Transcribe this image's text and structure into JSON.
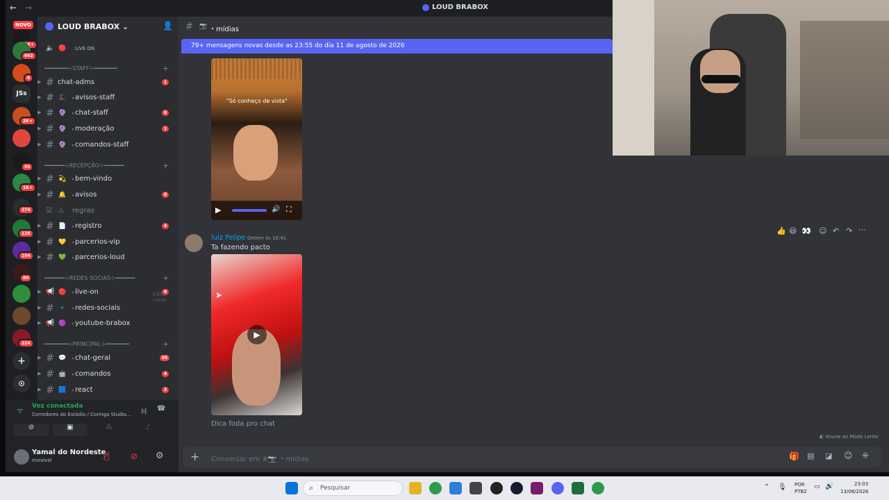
{
  "window": {
    "back": "←",
    "fwd": "→",
    "title": "LOUD BRABOX"
  },
  "servers": {
    "novo": "NOVO",
    "items": [
      {
        "badge": "1K+"
      },
      {
        "badge": "642"
      },
      {
        "badge": "6"
      },
      {
        "label": "JSs"
      },
      {
        "badge": "2K+"
      },
      {
        "badge": ""
      },
      {
        "badge": "95"
      },
      {
        "badge": "1K+"
      },
      {
        "badge": "374"
      },
      {
        "badge": "128"
      },
      {
        "badge": "104"
      },
      {
        "badge": "80"
      },
      {
        "badge": ""
      },
      {
        "badge": ""
      },
      {
        "badge": "224"
      }
    ],
    "add": "+",
    "explore": "⊙"
  },
  "server_name": "LOUD BRABOX",
  "channels": {
    "live_on_top": "LIVE ON",
    "cat_staff": "━━━━━━━⊹STAFF⊹━━━━━━━",
    "cat_recepcao": "━━━━━━⊹RECEPÇÃO⊹━━━━━━",
    "cat_redes": "━━━━━━⊹REDES SOCIAS⊹━━━━━━",
    "cat_principal": "━━━━━━━⊹PRINCIPAL⊹━━━━━━━",
    "items": [
      {
        "label": "chat-adms",
        "count": "1",
        "emoji": ""
      },
      {
        "label": "avisos-staff",
        "count": "",
        "emoji": "🎩"
      },
      {
        "label": "chat-staff",
        "count": "6",
        "emoji": "🔮"
      },
      {
        "label": "moderação",
        "count": "1",
        "emoji": "🔮"
      },
      {
        "label": "comandos-staff",
        "count": "",
        "emoji": "🔮"
      },
      {
        "label": "bem-vindo",
        "count": "",
        "emoji": "💫"
      },
      {
        "label": "avisos",
        "count": "8",
        "emoji": "🔔"
      },
      {
        "label": "regras",
        "count": "",
        "emoji": "⚠"
      },
      {
        "label": "registro",
        "count": "4",
        "emoji": "📄"
      },
      {
        "label": "parcerios-vip",
        "count": "",
        "emoji": "💛"
      },
      {
        "label": "parcerios-loud",
        "count": "",
        "emoji": "💚"
      },
      {
        "label": "live-on",
        "count": "6",
        "emoji": "🔴"
      },
      {
        "label": "redes-sociais",
        "count": "",
        "emoji": "🔹"
      },
      {
        "label": "youtube-brabox",
        "count": "",
        "emoji": "🟣"
      },
      {
        "label": "chat-geral",
        "count": "85",
        "emoji": "💬"
      },
      {
        "label": "comandos",
        "count": "4",
        "emoji": "🤖"
      },
      {
        "label": "react",
        "count": "3",
        "emoji": "🟦"
      }
    ],
    "tooltip": "Editar canal"
  },
  "voice": {
    "status": "Voz conectada",
    "location": "Corredores do Estádio / Coringa Studio..."
  },
  "user": {
    "name": "Yamal do Nordeste",
    "status": "Invisível"
  },
  "header": {
    "channel": "mídias"
  },
  "banner": "79+ mensagens novas desde as 23:55 do dia 11 de agosto de 2026",
  "video1": {
    "caption": "\"Só conheço de vista\""
  },
  "message": {
    "author": "luiz Felipe",
    "time": "Ontem às 16:41",
    "text": "Ta fazendo pacto",
    "next": "Dica foda pro chat"
  },
  "slowmode": "Imune ao Modo Lento",
  "composer": {
    "placeholder": "Conversar em #📷 ・mídias"
  },
  "taskbar": {
    "search": "Pesquisar",
    "lang1": "POR",
    "lang2": "PTB2",
    "time": "23:03",
    "date": "13/08/2026"
  },
  "colors": {
    "accent": "#5865f2",
    "mention": "#f23f43",
    "voice": "#23a55a",
    "author": "#00a8fc"
  }
}
